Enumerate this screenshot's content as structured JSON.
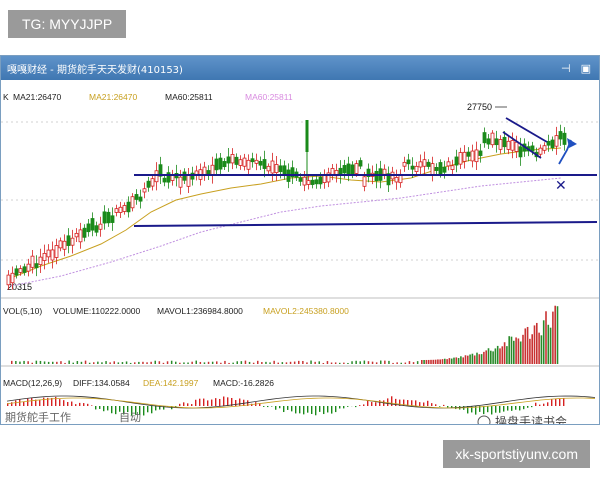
{
  "watermarks": {
    "top_left": "TG: MYYJJPP",
    "bottom_right": "xk-sportstiyunv.com"
  },
  "window": {
    "title": "嘎嘎财经 - 期货舵手天天发财(410153)"
  },
  "indicators": {
    "ma_prefix": "K",
    "ma21_a": "MA21:26470",
    "ma21_b": "MA21:26470",
    "ma60_a": "MA60:25811",
    "ma60_b": "MA60:25811",
    "ma60_b_color": "#d98be0",
    "ma21_color": "#c8a020",
    "high_label": "27750",
    "low_label": "20315",
    "vol_prefix": "VOL(5,10)",
    "volume": "VOLUME:110222.0000",
    "mavol1": "MAVOL1:236984.8000",
    "mavol2": "MAVOL2:245380.8000",
    "macd_prefix": "MACD(12,26,9)",
    "diff": "DIFF:134.0584",
    "dea": "DEA:142.1997",
    "macd": "MACD:-16.2826"
  },
  "overlay_text": {
    "wechat_mark": "操盘手读书会",
    "bottom_left_a": "期货舵手工作",
    "bottom_left_b": "自动"
  },
  "colors": {
    "up": "#d62020",
    "down": "#1a8a1a",
    "trendline": "#1a1a8a",
    "title_bar": "#4a82bf",
    "vol_up": "#c83232",
    "vol_down": "#2a8a2a"
  }
}
